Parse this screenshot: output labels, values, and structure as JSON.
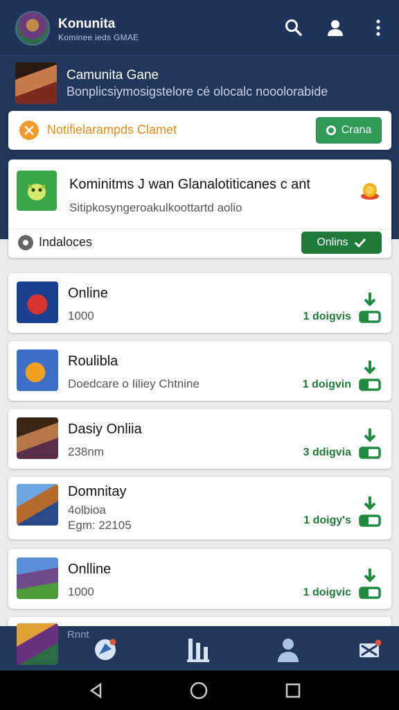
{
  "appbar": {
    "title": "Konunita",
    "subtitle": "Kominee ieds GMAE",
    "icons": [
      "search-icon",
      "account-icon",
      "more-vert-icon"
    ]
  },
  "game": {
    "title": "Camunita Gane",
    "description": "Bonplicsiymosigstelore cé olocalc nooolorabide"
  },
  "notification": {
    "text": "Notifielarampds Clamet",
    "button_label": "Crana",
    "colors": {
      "text": "#e28b1a",
      "button": "#2f9b54"
    }
  },
  "featured": {
    "title": "Kominitms J wan Glanalotiticanes c ant",
    "subtitle": "Sitipkosyngeroakulkoottartd aolio",
    "label": "Indaloces",
    "button_label": "Onlins"
  },
  "list": [
    {
      "title": "Online",
      "sub": "1000",
      "status": "1 doigvis"
    },
    {
      "title": "Roulibla",
      "sub": "Doedcare o Iiliey Chtnine",
      "status": "1 doigvin"
    },
    {
      "title": "Dasiy Onliia",
      "sub": "238nm",
      "status": "3 ddigvia"
    },
    {
      "title": "Domnitay",
      "sub": "4olbioa",
      "sub2": "Egm: 22105",
      "status": "1 doigy's"
    },
    {
      "title": "Onlline",
      "sub": "1000",
      "status": "1 doigvic"
    }
  ],
  "bottomnav": {
    "peek_label": "Rnnt",
    "icons": [
      "explore-icon",
      "leaderboard-icon",
      "profile-icon",
      "mail-icon"
    ]
  },
  "colors": {
    "primary": "#22375a",
    "accent_green": "#1f7a3a",
    "background": "#ebebeb"
  }
}
